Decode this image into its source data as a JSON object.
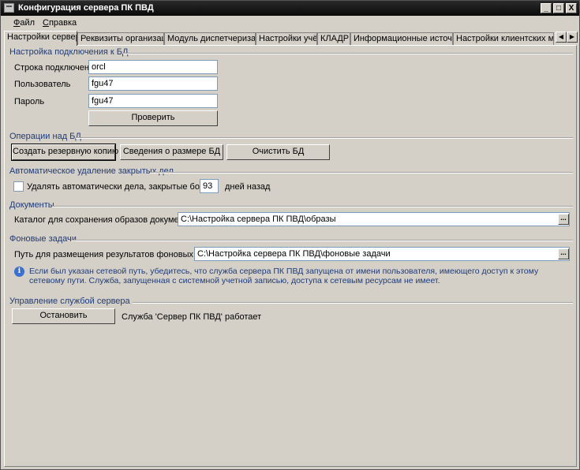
{
  "window": {
    "title": "Конфигурация сервера ПК ПВД",
    "controls": {
      "minimize": "_",
      "maximize": "□",
      "close": "X"
    }
  },
  "menu": {
    "file_rest": "айл",
    "file_accel": "Ф",
    "help_rest": "правка",
    "help_accel": "С"
  },
  "tabs": [
    {
      "label": "Настройки сервера",
      "active": true
    },
    {
      "label": "Реквизиты организации"
    },
    {
      "label": "Модуль диспетчеризации"
    },
    {
      "label": "Настройки учёта"
    },
    {
      "label": "КЛАДР"
    },
    {
      "label": "Информационные источники"
    },
    {
      "label": "Настройки клиентских мест"
    }
  ],
  "tab_scroll": {
    "left": "◀",
    "right": "▶"
  },
  "db": {
    "section": "Настройка подключения к БД",
    "connection_label": "Строка подключения",
    "connection_value": "orcl",
    "user_label": "Пользователь",
    "user_value": "fgu47",
    "password_label": "Пароль",
    "password_value": "fgu47",
    "check_button": "Проверить"
  },
  "ops": {
    "section": "Операции над БД",
    "backup_button": "Создать резервную копию",
    "size_button": "Сведения о размере БД",
    "clear_button": "Очистить БД"
  },
  "autodelete": {
    "section": "Автоматическое удаление закрытых дел",
    "checkbox_label": "Удалять автоматически дела, закрытые более",
    "days_value": "93",
    "days_suffix": "дней назад",
    "checked": false
  },
  "documents": {
    "section": "Документы",
    "catalog_label": "Каталог для сохранения образов документов",
    "catalog_value": "C:\\Настройка сервера ПК ПВД\\образы",
    "browse": "..."
  },
  "background": {
    "section": "Фоновые задачи",
    "path_label": "Путь для размещения результатов фоновых задач",
    "path_value": "C:\\Настройка сервера ПК ПВД\\фоновые задачи",
    "browse": "...",
    "info_icon": "info-icon",
    "info_text": "Если был указан сетевой путь, убедитесь, что служба сервера ПК ПВД запущена от имени пользователя, имеющего доступ к этому сетевому пути. Служба, запущенная с системной учетной записью, доступа к сетевым ресурсам не имеет."
  },
  "service": {
    "section": "Управление службой сервера",
    "stop_button": "Остановить",
    "status_text": "Служба 'Сервер ПК ПВД' работает"
  },
  "colors": {
    "section_text": "#1f3b7a",
    "info_icon": "#3b6fd0"
  }
}
